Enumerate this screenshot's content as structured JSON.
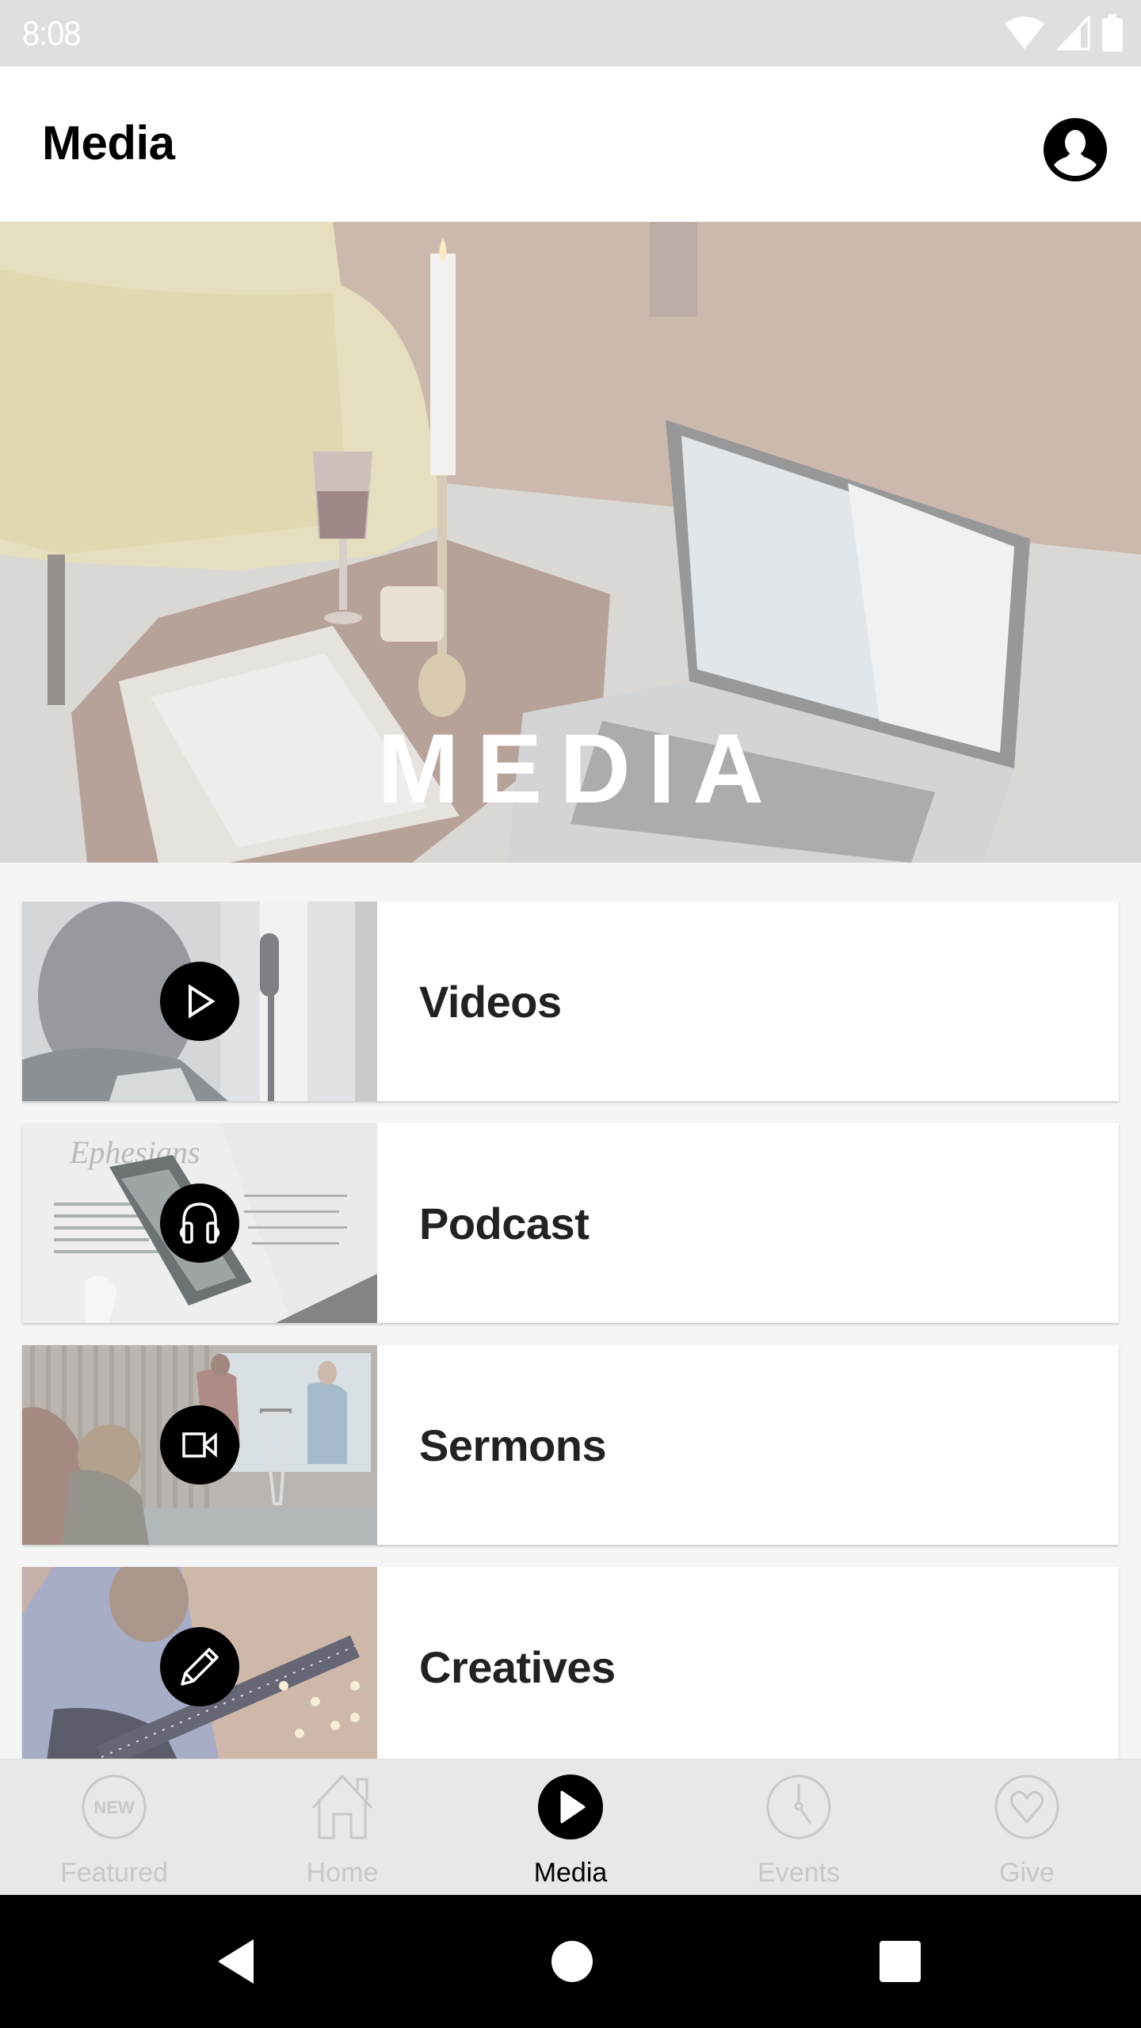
{
  "status_bar": {
    "time": "8:08",
    "icons": [
      "wifi-icon",
      "cell-signal-icon",
      "battery-icon"
    ]
  },
  "header": {
    "title": "Media",
    "profile_icon": "account-circle-icon"
  },
  "hero": {
    "title": "MEDIA"
  },
  "cards": [
    {
      "label": "Videos",
      "icon": "play-icon"
    },
    {
      "label": "Podcast",
      "icon": "headphones-icon"
    },
    {
      "label": "Sermons",
      "icon": "video-camera-icon"
    },
    {
      "label": "Creatives",
      "icon": "pencil-icon"
    }
  ],
  "bottom_nav": {
    "active": "Media",
    "items": [
      {
        "label": "Featured",
        "icon": "new-badge-icon",
        "badge_text": "NEW"
      },
      {
        "label": "Home",
        "icon": "home-icon"
      },
      {
        "label": "Media",
        "icon": "play-circle-icon"
      },
      {
        "label": "Events",
        "icon": "clock-icon"
      },
      {
        "label": "Give",
        "icon": "heart-icon"
      }
    ]
  },
  "system_nav": {
    "buttons": [
      "back-icon",
      "home-circle-icon",
      "recents-icon"
    ]
  },
  "colors": {
    "status_bar_bg": "#dfdfdf",
    "page_bg": "#f5f5f5",
    "nav_bg": "#e8e8e8",
    "nav_inactive": "#c8c8c8",
    "nav_active": "#000000",
    "card_text": "#222222"
  }
}
